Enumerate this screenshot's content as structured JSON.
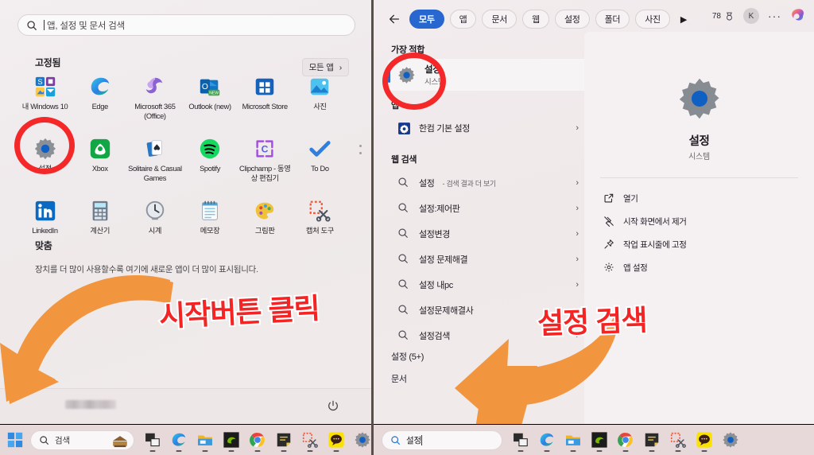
{
  "left": {
    "search": {
      "placeholder": "앱, 설정 및 문서 검색",
      "icon": "search-icon"
    },
    "pinned_header": "고정됨",
    "all_apps_label": "모든 앱",
    "pinned_apps": [
      {
        "label": "내 Windows 10",
        "icon": "windows10-app-icon"
      },
      {
        "label": "Edge",
        "icon": "edge-icon"
      },
      {
        "label": "Microsoft 365 (Office)",
        "icon": "microsoft365-icon"
      },
      {
        "label": "Outlook (new)",
        "icon": "outlook-icon"
      },
      {
        "label": "Microsoft Store",
        "icon": "microsoft-store-icon"
      },
      {
        "label": "사진",
        "icon": "photos-icon"
      },
      {
        "label": "설정",
        "icon": "settings-gear-icon"
      },
      {
        "label": "Xbox",
        "icon": "xbox-icon"
      },
      {
        "label": "Solitaire & Casual Games",
        "icon": "solitaire-icon"
      },
      {
        "label": "Spotify",
        "icon": "spotify-icon"
      },
      {
        "label": "Clipchamp - 동영상 편집기",
        "icon": "clipchamp-icon"
      },
      {
        "label": "To Do",
        "icon": "todo-icon"
      },
      {
        "label": "LinkedIn",
        "icon": "linkedin-icon"
      },
      {
        "label": "계산기",
        "icon": "calculator-icon"
      },
      {
        "label": "시계",
        "icon": "clock-icon"
      },
      {
        "label": "메모장",
        "icon": "notepad-icon"
      },
      {
        "label": "그림판",
        "icon": "paint-icon"
      },
      {
        "label": "캡처 도구",
        "icon": "snipping-tool-icon"
      }
    ],
    "recommended_header": "맞춤",
    "recommended_text": "장치를 더 많이 사용할수록 여기에 새로운 앱이 더 많이 표시됩니다.",
    "power_icon": "power-icon"
  },
  "left_taskbar": {
    "start_icon": "windows-start-icon",
    "search_placeholder": "검색",
    "widget_icon": "weather-widget-icon",
    "icons": [
      {
        "name": "task-view-icon"
      },
      {
        "name": "edge-icon"
      },
      {
        "name": "file-explorer-icon"
      },
      {
        "name": "nvidia-icon"
      },
      {
        "name": "chrome-icon"
      },
      {
        "name": "sticky-notes-icon"
      },
      {
        "name": "snipping-tool-icon"
      },
      {
        "name": "kakaotalk-icon"
      },
      {
        "name": "settings-gear-icon"
      }
    ]
  },
  "right": {
    "back_icon": "back-arrow-icon",
    "filters": [
      {
        "label": "모두",
        "active": true
      },
      {
        "label": "앱",
        "active": false
      },
      {
        "label": "문서",
        "active": false
      },
      {
        "label": "웹",
        "active": false
      },
      {
        "label": "설정",
        "active": false
      },
      {
        "label": "폴더",
        "active": false
      },
      {
        "label": "사진",
        "active": false
      }
    ],
    "more_filters_icon": "play-triangle-icon",
    "rewards_points": "78",
    "rewards_icon": "rewards-medal-icon",
    "avatar_initial": "K",
    "more_label": "···",
    "copilot_icon": "copilot-icon",
    "best_match_header": "가장 적합",
    "best_match": {
      "title": "설정",
      "subtitle": "시스템",
      "icon": "settings-gear-icon"
    },
    "apps_header": "앱",
    "app_results": [
      {
        "label": "한컴 기본 설정",
        "icon": "hancom-settings-icon",
        "chevron": "›"
      }
    ],
    "web_header": "웹 검색",
    "web_results": [
      {
        "label": "설정",
        "suffix": " - 검색 결과 더 보기",
        "icon": "search-icon",
        "chevron": "›"
      },
      {
        "label": "설정:제어판",
        "suffix": "",
        "icon": "search-icon",
        "chevron": "›"
      },
      {
        "label": "설정변경",
        "suffix": "",
        "icon": "search-icon",
        "chevron": "›"
      },
      {
        "label": "설정 문제해결",
        "suffix": "",
        "icon": "search-icon",
        "chevron": "›"
      },
      {
        "label": "설정 내pc",
        "suffix": "",
        "icon": "search-icon",
        "chevron": "›"
      },
      {
        "label": "설정문제해결사",
        "suffix": "",
        "icon": "search-icon",
        "chevron": "›"
      },
      {
        "label": "설정검색",
        "suffix": "",
        "icon": "search-icon",
        "chevron": "›"
      }
    ],
    "footer_settings": "설정 (5+)",
    "footer_documents": "문서",
    "preview": {
      "icon": "settings-gear-icon",
      "title": "설정",
      "subtitle": "시스템",
      "actions": [
        {
          "label": "열기",
          "icon": "open-external-icon"
        },
        {
          "label": "시작 화면에서 제거",
          "icon": "unpin-start-icon"
        },
        {
          "label": "작업 표시줄에 고정",
          "icon": "pin-taskbar-icon"
        },
        {
          "label": "앱 설정",
          "icon": "gear-icon"
        }
      ]
    }
  },
  "right_taskbar": {
    "search_value": "설정",
    "search_icon": "search-icon",
    "icons": [
      {
        "name": "task-view-icon"
      },
      {
        "name": "edge-icon"
      },
      {
        "name": "file-explorer-icon"
      },
      {
        "name": "nvidia-icon"
      },
      {
        "name": "chrome-icon"
      },
      {
        "name": "sticky-notes-icon"
      },
      {
        "name": "snipping-tool-icon"
      },
      {
        "name": "kakaotalk-icon"
      },
      {
        "name": "settings-gear-icon"
      }
    ]
  },
  "annotations": {
    "left_text": "시작버튼 클릭",
    "right_text": "설정 검색",
    "arrow_color": "#f2953f",
    "highlight_color": "#f42828",
    "text_color": "#f42424"
  }
}
